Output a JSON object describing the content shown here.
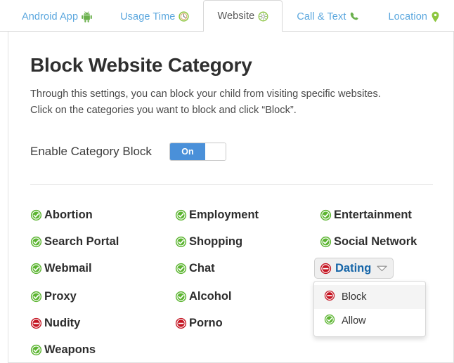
{
  "tabs": [
    {
      "label": "Android App",
      "icon": "android-icon",
      "active": false
    },
    {
      "label": "Usage Time",
      "icon": "clock-icon",
      "active": false
    },
    {
      "label": "Website",
      "icon": "globe-icon",
      "active": true
    },
    {
      "label": "Call & Text",
      "icon": "phone-icon",
      "active": false
    },
    {
      "label": "Location",
      "icon": "map-pin-icon",
      "active": false
    }
  ],
  "page": {
    "title": "Block Website Category",
    "description_line1": "Through this settings, you can block your child from visiting specific websites.",
    "description_line2": "Click on the categories you want to block and click “Block”."
  },
  "enable": {
    "label": "Enable Category Block",
    "toggle_state": "On",
    "toggle_on": true
  },
  "categories": [
    {
      "label": "Abortion",
      "status": "allow"
    },
    {
      "label": "Employment",
      "status": "allow"
    },
    {
      "label": "Entertainment",
      "status": "allow"
    },
    {
      "label": "Search Portal",
      "status": "allow"
    },
    {
      "label": "Shopping",
      "status": "allow"
    },
    {
      "label": "Social Network",
      "status": "allow"
    },
    {
      "label": "Webmail",
      "status": "allow"
    },
    {
      "label": "Chat",
      "status": "allow"
    },
    {
      "label": "Dating",
      "status": "block",
      "open": true
    },
    {
      "label": "Proxy",
      "status": "allow"
    },
    {
      "label": "Alcohol",
      "status": "allow"
    },
    {
      "label": "",
      "status": "empty"
    },
    {
      "label": "Nudity",
      "status": "block"
    },
    {
      "label": "Porno",
      "status": "block"
    },
    {
      "label": "",
      "status": "empty"
    },
    {
      "label": "Weapons",
      "status": "allow"
    },
    {
      "label": "",
      "status": "empty"
    },
    {
      "label": "",
      "status": "empty"
    }
  ],
  "dropdown": {
    "items": [
      {
        "label": "Block",
        "icon": "block-icon",
        "hover": true
      },
      {
        "label": "Allow",
        "icon": "check-icon",
        "hover": false
      }
    ]
  },
  "colors": {
    "tab_link": "#5ba7de",
    "tab_active_text": "#555555",
    "accent_blue": "#4a90d9",
    "allow_green": "#5cb531",
    "block_red": "#c41421",
    "dating_text": "#1565a8"
  }
}
